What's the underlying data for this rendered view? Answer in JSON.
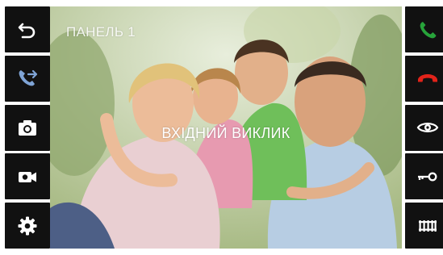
{
  "screen": {
    "panel_label": "ПАНЕЛЬ 1",
    "call_status": "ВХІДНИЙ ВИКЛИК"
  },
  "left_buttons": [
    {
      "icon": "back-arrow-icon"
    },
    {
      "icon": "call-transfer-icon"
    },
    {
      "icon": "camera-icon"
    },
    {
      "icon": "video-record-icon"
    },
    {
      "icon": "settings-gear-icon"
    }
  ],
  "right_buttons": [
    {
      "icon": "answer-call-icon"
    },
    {
      "icon": "hang-up-icon"
    },
    {
      "icon": "monitor-eye-icon"
    },
    {
      "icon": "unlock-key-icon"
    },
    {
      "icon": "gate-icon"
    }
  ],
  "colors": {
    "button_bg": "#111111",
    "icon_white": "#ffffff",
    "transfer_blue": "#7fa4d6",
    "answer_green": "#27a33a",
    "hangup_red": "#e2231a"
  }
}
